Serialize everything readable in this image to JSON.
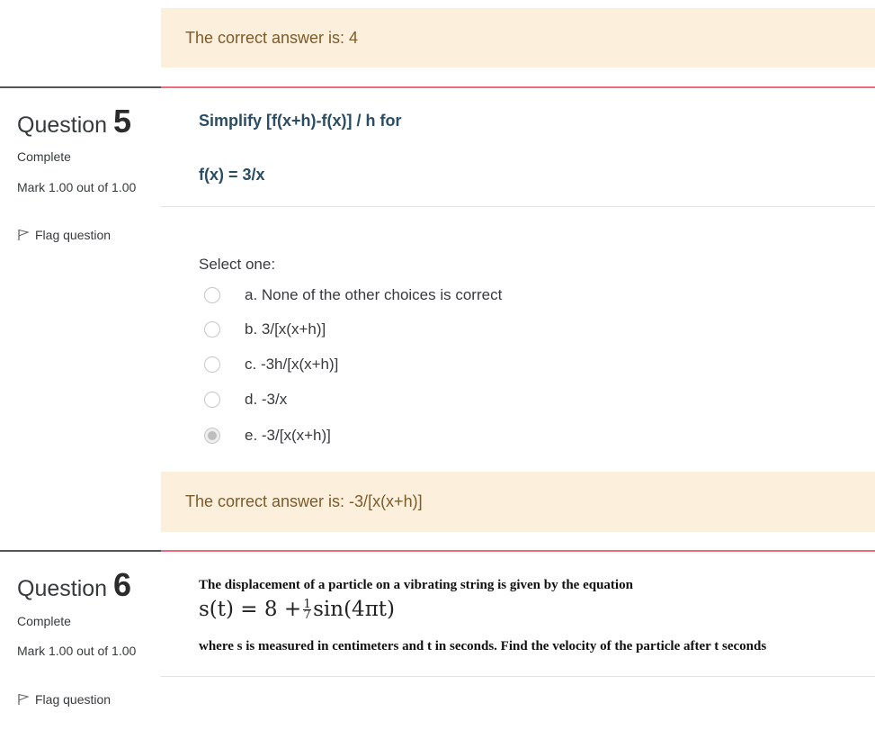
{
  "prev_feedback": {
    "text": "The correct answer is: 4"
  },
  "q5": {
    "title_word": "Question",
    "number": "5",
    "state": "Complete",
    "mark": "Mark 1.00 out of 1.00",
    "flag_label": "Flag question",
    "question_line1": "Simplify [f(x+h)-f(x)] / h for",
    "question_line2": "f(x) = 3/x",
    "select_label": "Select one:",
    "options": [
      {
        "label": "a. None of the other choices is correct",
        "checked": false
      },
      {
        "label": "b. 3/[x(x+h)]",
        "checked": false
      },
      {
        "label": "c. -3h/[x(x+h)]",
        "checked": false
      },
      {
        "label": "d. -3/x",
        "checked": false
      },
      {
        "label": "e. -3/[x(x+h)]",
        "checked": true
      }
    ],
    "feedback": "The correct answer is: -3/[x(x+h)]"
  },
  "q6": {
    "title_word": "Question",
    "number": "6",
    "state": "Complete",
    "mark": "Mark 1.00 out of 1.00",
    "flag_label": "Flag question",
    "text_line1": "The displacement of a particle on a vibrating string is given by the equation",
    "equation_left": "s(t) = 8 +",
    "equation_frac_num": "1",
    "equation_frac_den": "7",
    "equation_right": "sin(4πt)",
    "text_line2": "where s is measured in centimeters and t in seconds. Find the velocity of the particle after t seconds"
  },
  "colors": {
    "feedback_bg": "#fcefdc",
    "feedback_text": "#7d5a29",
    "accent_rule": "#ec6b7e",
    "question_text": "#2a4d63"
  }
}
